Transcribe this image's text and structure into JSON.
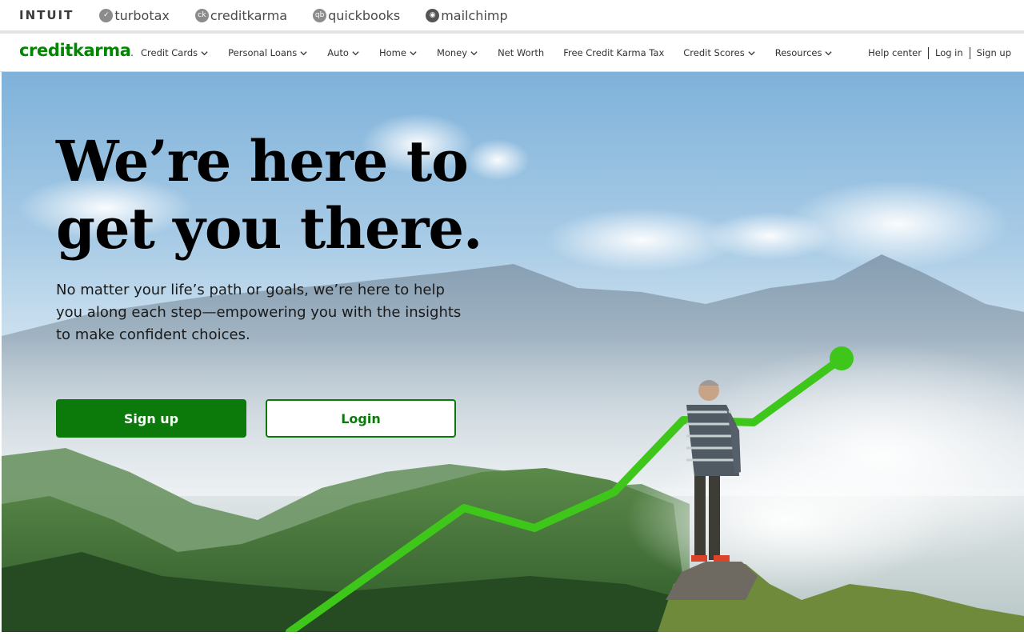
{
  "brand_bar": {
    "brands": [
      {
        "name": "INTUIT",
        "icon": ""
      },
      {
        "name": "turbotax",
        "icon": "turbotax-check-icon"
      },
      {
        "name": "creditkarma",
        "icon": "creditkarma-ck-icon",
        "glyph": "ck"
      },
      {
        "name": "quickbooks",
        "icon": "quickbooks-qb-icon",
        "glyph": "qb"
      },
      {
        "name": "mailchimp",
        "icon": "mailchimp-freddie-icon"
      }
    ]
  },
  "nav": {
    "logo": "creditkarma",
    "items": [
      {
        "label": "Credit Cards",
        "dropdown": true
      },
      {
        "label": "Personal Loans",
        "dropdown": true
      },
      {
        "label": "Auto",
        "dropdown": true
      },
      {
        "label": "Home",
        "dropdown": true
      },
      {
        "label": "Money",
        "dropdown": true
      },
      {
        "label": "Net Worth",
        "dropdown": false
      },
      {
        "label": "Free Credit Karma Tax",
        "dropdown": false
      },
      {
        "label": "Credit Scores",
        "dropdown": true
      },
      {
        "label": "Resources",
        "dropdown": true
      }
    ],
    "right_links": [
      "Help center",
      "Log in",
      "Sign up"
    ]
  },
  "hero": {
    "title_line1": "We’re here to",
    "title_line2": "get you there.",
    "subtitle": "No matter your life’s path or goals, we’re here to help you along each step—empowering you with the insights to make confident choices.",
    "signup_label": "Sign up",
    "login_label": "Login"
  },
  "colors": {
    "brand_green": "#008600",
    "button_green": "#0b7a0b",
    "chart_line": "#3ec71a"
  }
}
